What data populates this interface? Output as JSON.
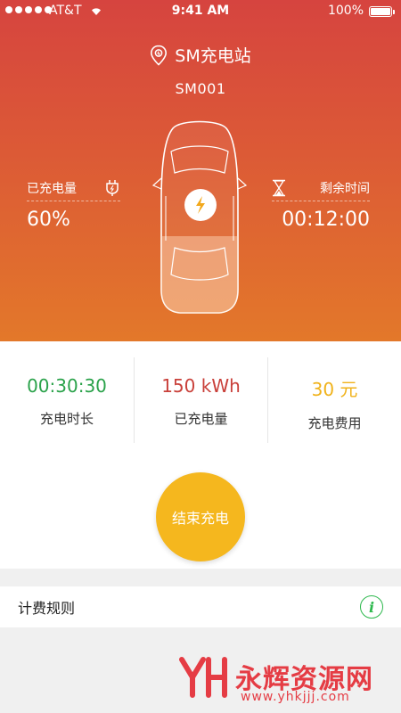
{
  "status_bar": {
    "carrier": "AT&T",
    "time": "9:41 AM",
    "battery": "100%"
  },
  "station": {
    "name": "SM充电站",
    "code": "SM001"
  },
  "charged": {
    "label": "已充电量",
    "value": "60%"
  },
  "remaining": {
    "label": "剩余时间",
    "value": "00:12:00"
  },
  "metrics": [
    {
      "value": "00:30:30",
      "label": "充电时长",
      "color": "#2aa24a"
    },
    {
      "value": "150 kWh",
      "label": "已充电量",
      "color": "#c9403a"
    },
    {
      "value": "30 元",
      "label": "充电费用",
      "color": "#f0b21a"
    }
  ],
  "end_button_label": "结束充电",
  "rules": {
    "label": "计费规则"
  },
  "watermark": {
    "text": "永辉资源网",
    "url": "www.yhkjjj.com"
  }
}
